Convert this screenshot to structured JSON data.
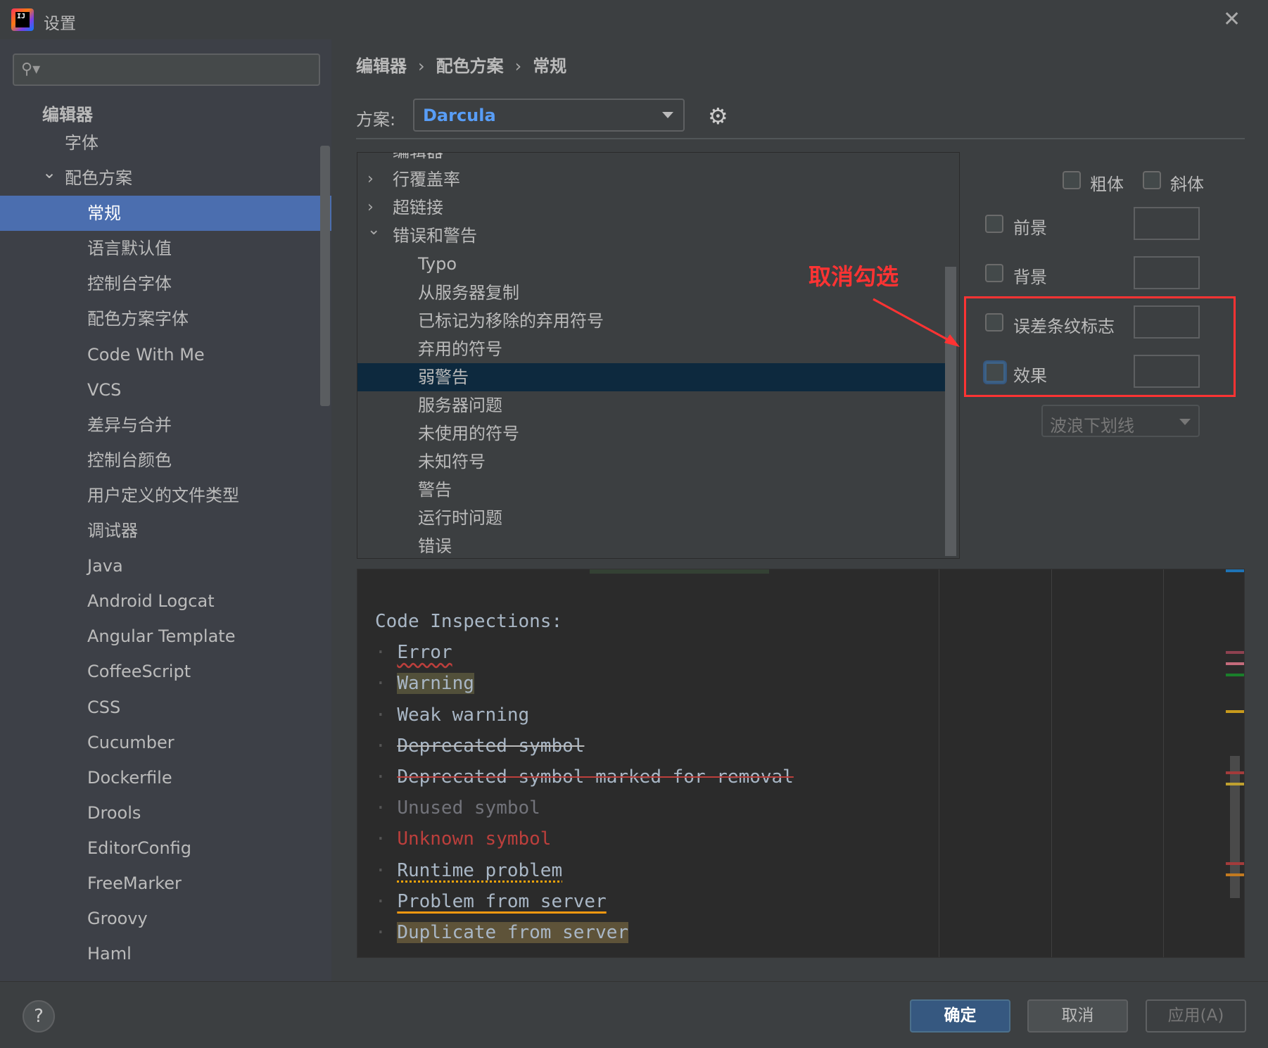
{
  "window": {
    "title": "设置",
    "close_icon": "close-icon"
  },
  "sidebar": {
    "search_placeholder": "",
    "items": [
      {
        "label": "编辑器",
        "level": 0,
        "bold": true
      },
      {
        "label": "字体",
        "level": 1
      },
      {
        "label": "配色方案",
        "level": 1,
        "expanded": true
      },
      {
        "label": "常规",
        "level": 2,
        "selected": true
      },
      {
        "label": "语言默认值",
        "level": 2
      },
      {
        "label": "控制台字体",
        "level": 2
      },
      {
        "label": "配色方案字体",
        "level": 2
      },
      {
        "label": "Code With Me",
        "level": 2
      },
      {
        "label": "VCS",
        "level": 2
      },
      {
        "label": "差异与合并",
        "level": 2
      },
      {
        "label": "控制台颜色",
        "level": 2
      },
      {
        "label": "用户定义的文件类型",
        "level": 2
      },
      {
        "label": "调试器",
        "level": 2
      },
      {
        "label": "Java",
        "level": 2
      },
      {
        "label": "Android Logcat",
        "level": 2
      },
      {
        "label": "Angular Template",
        "level": 2
      },
      {
        "label": "CoffeeScript",
        "level": 2
      },
      {
        "label": "CSS",
        "level": 2
      },
      {
        "label": "Cucumber",
        "level": 2
      },
      {
        "label": "Dockerfile",
        "level": 2
      },
      {
        "label": "Drools",
        "level": 2
      },
      {
        "label": "EditorConfig",
        "level": 2
      },
      {
        "label": "FreeMarker",
        "level": 2
      },
      {
        "label": "Groovy",
        "level": 2
      },
      {
        "label": "Haml",
        "level": 2
      }
    ]
  },
  "breadcrumb": [
    "编辑器",
    "配色方案",
    "常规"
  ],
  "scheme": {
    "label": "方案:",
    "value": "Darcula"
  },
  "tree": {
    "items": [
      {
        "label": "编辑器",
        "level": 0,
        "arrow": "expanded"
      },
      {
        "label": "行覆盖率",
        "level": 0,
        "arrow": "collapsed"
      },
      {
        "label": "超链接",
        "level": 0,
        "arrow": "collapsed"
      },
      {
        "label": "错误和警告",
        "level": 0,
        "arrow": "expanded"
      },
      {
        "label": "Typo",
        "level": 1
      },
      {
        "label": "从服务器复制",
        "level": 1
      },
      {
        "label": "已标记为移除的弃用符号",
        "level": 1
      },
      {
        "label": "弃用的符号",
        "level": 1
      },
      {
        "label": "弱警告",
        "level": 1,
        "selected": true
      },
      {
        "label": "服务器问题",
        "level": 1
      },
      {
        "label": "未使用的符号",
        "level": 1
      },
      {
        "label": "未知符号",
        "level": 1
      },
      {
        "label": "警告",
        "level": 1
      },
      {
        "label": "运行时问题",
        "level": 1
      },
      {
        "label": "错误",
        "level": 1
      }
    ]
  },
  "options": {
    "bold": {
      "label": "粗体",
      "checked": false
    },
    "italic": {
      "label": "斜体",
      "checked": false
    },
    "foreground": {
      "label": "前景",
      "checked": false
    },
    "background": {
      "label": "背景",
      "checked": false
    },
    "error_stripe": {
      "label": "误差条纹标志",
      "checked": false
    },
    "effects": {
      "label": "效果",
      "checked": false
    },
    "effect_type": "波浪下划线"
  },
  "annotation": {
    "text": "取消勾选",
    "color": "#ff3333"
  },
  "preview": {
    "lines": [
      {
        "text": "Code Inspections:",
        "indent": false,
        "style": "plain"
      },
      {
        "text": "Error",
        "style": "error"
      },
      {
        "text": "Warning",
        "style": "warning"
      },
      {
        "text": "Weak warning",
        "style": "weak"
      },
      {
        "text": "Deprecated symbol",
        "style": "deprecated"
      },
      {
        "text": "Deprecated symbol marked for removal",
        "style": "removal"
      },
      {
        "text": "Unused symbol",
        "style": "unused"
      },
      {
        "text": "Unknown symbol",
        "style": "unknown"
      },
      {
        "text": "Runtime problem",
        "style": "runtime"
      },
      {
        "text": "Problem from server",
        "style": "server"
      },
      {
        "text": "Duplicate from server",
        "style": "duplicate"
      }
    ],
    "stripe_marks": [
      "#1e73b5",
      "#8e4150",
      "#c46b7c",
      "#1a7f2b",
      "#c89a1c",
      "#a33b3b",
      "#bfa030",
      "#a33b3b",
      "#c27a20"
    ]
  },
  "buttons": {
    "ok": "确定",
    "cancel": "取消",
    "apply": "应用(A)",
    "help": "?"
  },
  "colors": {
    "accent": "#4b6eaf",
    "selection": "#0d293e",
    "link": "#589df6"
  }
}
